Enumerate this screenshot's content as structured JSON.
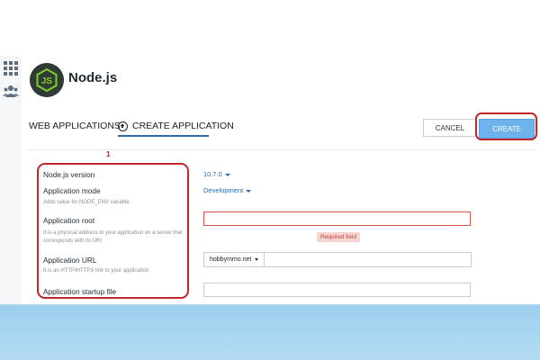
{
  "header": {
    "app_title": "Node.js",
    "logo_text": "JS"
  },
  "tabs": [
    {
      "label": "WEB APPLICATIONS",
      "active": false
    },
    {
      "label": "CREATE APPLICATION",
      "active": true
    }
  ],
  "toolbar": {
    "cancel_label": "CANCEL",
    "create_label": "CREATE"
  },
  "annotation": {
    "marker": "1"
  },
  "form": {
    "nodejs_version": {
      "label": "Node.js version",
      "value": "10.7.0"
    },
    "application_mode": {
      "label": "Application mode",
      "hint": "Adds value for NODE_ENV variable",
      "value": "Development"
    },
    "application_root": {
      "label": "Application root",
      "hint": "It is a physical address to your application on a server that corresponds with its URI",
      "value": "",
      "error": "Required field"
    },
    "application_url": {
      "label": "Application URL",
      "hint": "It is an HTTP/HTTPS link to your application",
      "domain": "hobbymmo.net",
      "path": ""
    },
    "startup_file": {
      "label": "Application startup file",
      "value": ""
    }
  },
  "colors": {
    "accent": "#2f6aa3",
    "create_button": "#6fb3ec",
    "annotation_red": "#c0262c",
    "error_bg": "#f7d4d2",
    "error_text": "#c4433f"
  }
}
